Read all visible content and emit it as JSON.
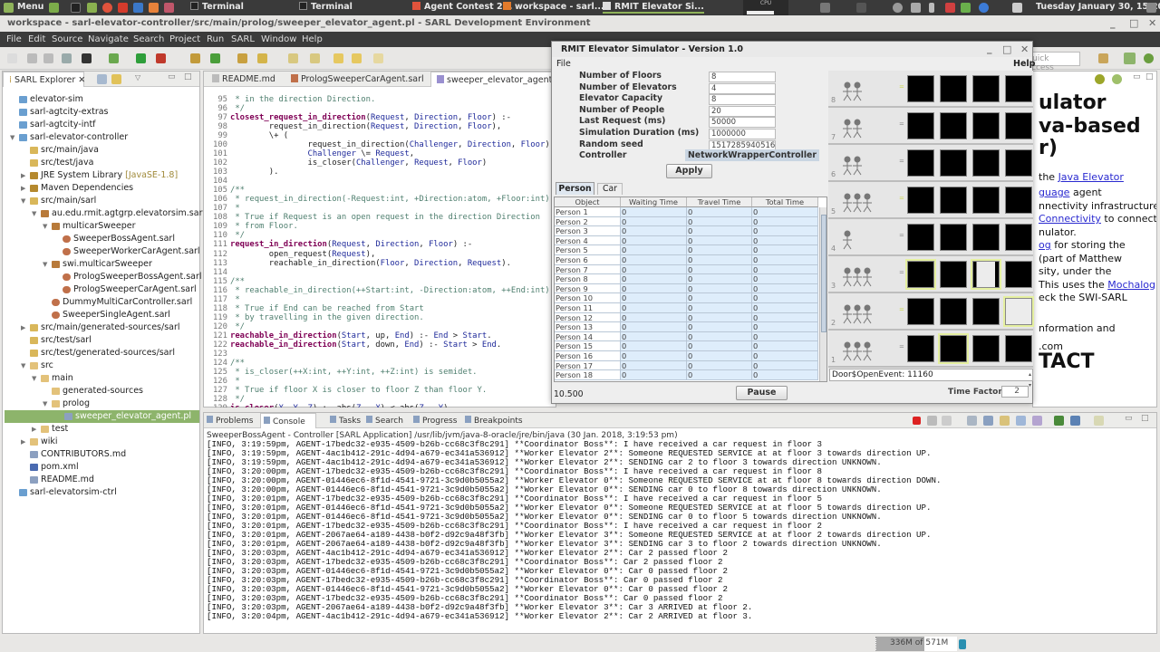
{
  "taskbar": {
    "menu": "Menu",
    "windows": [
      {
        "label": "Terminal",
        "active": false
      },
      {
        "label": "Terminal",
        "active": false
      },
      {
        "label": "Agent Contest 2...",
        "active": false
      },
      {
        "label": "workspace - sarl...",
        "active": false
      },
      {
        "label": "RMIT Elevator Si...",
        "active": true
      }
    ],
    "cpu": "CPU",
    "clock": "Tuesday January 30, 15:20"
  },
  "window": {
    "title": "workspace - sarl-elevator-controller/src/main/prolog/sweeper_elevator_agent.pl - SARL Development Environment"
  },
  "menu": [
    "File",
    "Edit",
    "Source",
    "Navigate",
    "Search",
    "Project",
    "Run",
    "SARL",
    "Window",
    "Help"
  ],
  "quick_access": {
    "placeholder": "Quick Access"
  },
  "explorer": {
    "title": "SARL Explorer",
    "items": [
      {
        "level": 0,
        "label": "elevator-sim",
        "icon": "project",
        "exp": ""
      },
      {
        "level": 0,
        "label": "sarl-agtcity-extras",
        "icon": "project",
        "exp": ""
      },
      {
        "level": 0,
        "label": "sarl-agtcity-intf",
        "icon": "project",
        "exp": ""
      },
      {
        "level": 0,
        "label": "sarl-elevator-controller",
        "icon": "project",
        "exp": "open"
      },
      {
        "level": 1,
        "label": "src/main/java",
        "icon": "srcfolder",
        "exp": ""
      },
      {
        "level": 1,
        "label": "src/test/java",
        "icon": "srcfolder",
        "exp": ""
      },
      {
        "level": 1,
        "label": "JRE System Library",
        "suffix": "[JavaSE-1.8]",
        "icon": "library",
        "exp": "closed"
      },
      {
        "level": 1,
        "label": "Maven Dependencies",
        "icon": "library",
        "exp": "closed"
      },
      {
        "level": 1,
        "label": "src/main/sarl",
        "icon": "srcfolder",
        "exp": "open"
      },
      {
        "level": 2,
        "label": "au.edu.rmit.agtgrp.elevatorsim.sarlctr",
        "icon": "package",
        "exp": "open"
      },
      {
        "level": 3,
        "label": "multicarSweeper",
        "icon": "package",
        "exp": "open"
      },
      {
        "level": 4,
        "label": "SweeperBossAgent.sarl",
        "icon": "sarl",
        "exp": ""
      },
      {
        "level": 4,
        "label": "SweeperWorkerCarAgent.sarl",
        "icon": "sarl",
        "exp": ""
      },
      {
        "level": 3,
        "label": "swi.multicarSweeper",
        "icon": "package",
        "exp": "open"
      },
      {
        "level": 4,
        "label": "PrologSweeperBossAgent.sarl",
        "icon": "sarl",
        "exp": ""
      },
      {
        "level": 4,
        "label": "PrologSweeperCarAgent.sarl",
        "icon": "sarl",
        "exp": ""
      },
      {
        "level": 3,
        "label": "DummyMultiCarController.sarl",
        "icon": "sarl",
        "exp": ""
      },
      {
        "level": 3,
        "label": "SweeperSingleAgent.sarl",
        "icon": "sarl",
        "exp": ""
      },
      {
        "level": 1,
        "label": "src/main/generated-sources/sarl",
        "icon": "srcfolder",
        "exp": "closed"
      },
      {
        "level": 1,
        "label": "src/test/sarl",
        "icon": "srcfolder",
        "exp": ""
      },
      {
        "level": 1,
        "label": "src/test/generated-sources/sarl",
        "icon": "srcfolder",
        "exp": ""
      },
      {
        "level": 1,
        "label": "src",
        "icon": "folder",
        "exp": "open"
      },
      {
        "level": 2,
        "label": "main",
        "icon": "folder",
        "exp": "open"
      },
      {
        "level": 3,
        "label": "generated-sources",
        "icon": "folder",
        "exp": ""
      },
      {
        "level": 3,
        "label": "prolog",
        "icon": "folder",
        "exp": "open"
      },
      {
        "level": 4,
        "label": "sweeper_elevator_agent.pl",
        "icon": "file",
        "exp": "",
        "selected": true
      },
      {
        "level": 2,
        "label": "test",
        "icon": "folder",
        "exp": "closed"
      },
      {
        "level": 1,
        "label": "wiki",
        "icon": "folder",
        "exp": "closed"
      },
      {
        "level": 1,
        "label": "CONTRIBUTORS.md",
        "icon": "file",
        "exp": ""
      },
      {
        "level": 1,
        "label": "pom.xml",
        "icon": "xml",
        "exp": ""
      },
      {
        "level": 1,
        "label": "README.md",
        "icon": "file",
        "exp": ""
      },
      {
        "level": 0,
        "label": "sarl-elevatorsim-ctrl",
        "icon": "project",
        "exp": ""
      }
    ]
  },
  "editor": {
    "tabs": [
      {
        "label": "README.md",
        "active": false
      },
      {
        "label": "PrologSweeperCarAgent.sarl",
        "active": false
      },
      {
        "label": "sweeper_elevator_agent.pl",
        "active": true
      }
    ],
    "lines": [
      {
        "n": 95,
        "t": " * in the direction Direction."
      },
      {
        "n": 96,
        "t": " */"
      },
      {
        "n": 97,
        "t": "closest_request_in_direction(Request, Direction, Floor) :-"
      },
      {
        "n": 98,
        "t": "        request_in_direction(Request, Direction, Floor),"
      },
      {
        "n": 99,
        "t": "        \\+ ("
      },
      {
        "n": 100,
        "t": "                request_in_direction(Challenger, Direction, Floor),"
      },
      {
        "n": 101,
        "t": "                Challenger \\= Request,"
      },
      {
        "n": 102,
        "t": "                is_closer(Challenger, Request, Floor)"
      },
      {
        "n": 103,
        "t": "        )."
      },
      {
        "n": 104,
        "t": ""
      },
      {
        "n": 105,
        "t": "/**"
      },
      {
        "n": 106,
        "t": " * request_in_direction(-Request:int, +Direction:atom, +Floor:int)"
      },
      {
        "n": 107,
        "t": " *"
      },
      {
        "n": 108,
        "t": " * True if Request is an open request in the direction Direction"
      },
      {
        "n": 109,
        "t": " * from Floor."
      },
      {
        "n": 110,
        "t": " */"
      },
      {
        "n": 111,
        "t": "request_in_direction(Request, Direction, Floor) :-"
      },
      {
        "n": 112,
        "t": "        open_request(Request),"
      },
      {
        "n": 113,
        "t": "        reachable_in_direction(Floor, Direction, Request)."
      },
      {
        "n": 114,
        "t": ""
      },
      {
        "n": 115,
        "t": "/**"
      },
      {
        "n": 116,
        "t": " * reachable_in_direction(++Start:int, -Direction:atom, ++End:int)"
      },
      {
        "n": 117,
        "t": " *"
      },
      {
        "n": 118,
        "t": " * True if End can be reached from Start"
      },
      {
        "n": 119,
        "t": " * by travelling in the given direction."
      },
      {
        "n": 120,
        "t": " */"
      },
      {
        "n": 121,
        "t": "reachable_in_direction(Start, up, End) :- End > Start."
      },
      {
        "n": 122,
        "t": "reachable_in_direction(Start, down, End) :- Start > End."
      },
      {
        "n": 123,
        "t": ""
      },
      {
        "n": 124,
        "t": "/**"
      },
      {
        "n": 125,
        "t": " * is_closer(++X:int, ++Y:int, ++Z:int) is semidet."
      },
      {
        "n": 126,
        "t": " *"
      },
      {
        "n": 127,
        "t": " * True if floor X is closer to floor Z than floor Y."
      },
      {
        "n": 128,
        "t": " */"
      },
      {
        "n": 129,
        "t": "is_closer(X, Y, Z) :- abs(Z - X) < abs(Z - Y)."
      }
    ]
  },
  "simulator": {
    "title": "RMIT Elevator Simulator - Version 1.0",
    "menu_file": "File",
    "menu_help": "Help",
    "fields": [
      {
        "label": "Number of Floors",
        "value": "8"
      },
      {
        "label": "Number of Elevators",
        "value": "4"
      },
      {
        "label": "Elevator Capacity",
        "value": "8"
      },
      {
        "label": "Number of People",
        "value": "20"
      },
      {
        "label": "Last Request (ms)",
        "value": "50000"
      },
      {
        "label": "Simulation Duration (ms)",
        "value": "1000000"
      },
      {
        "label": "Random seed",
        "value": "1517285940516"
      }
    ],
    "controller_label": "Controller",
    "controller_value": "NetworkWrapperController",
    "apply": "Apply",
    "tabs": [
      "Person",
      "Car"
    ],
    "columns": [
      "Object",
      "Waiting Time",
      "Travel Time",
      "Total Time"
    ],
    "rows": [
      [
        "Person 1",
        "0",
        "0",
        "0"
      ],
      [
        "Person 2",
        "0",
        "0",
        "0"
      ],
      [
        "Person 3",
        "0",
        "0",
        "0"
      ],
      [
        "Person 4",
        "0",
        "0",
        "0"
      ],
      [
        "Person 5",
        "0",
        "0",
        "0"
      ],
      [
        "Person 6",
        "0",
        "0",
        "0"
      ],
      [
        "Person 7",
        "0",
        "0",
        "0"
      ],
      [
        "Person 8",
        "0",
        "0",
        "0"
      ],
      [
        "Person 9",
        "0",
        "0",
        "0"
      ],
      [
        "Person 10",
        "0",
        "0",
        "0"
      ],
      [
        "Person 11",
        "0",
        "0",
        "0"
      ],
      [
        "Person 12",
        "0",
        "0",
        "0"
      ],
      [
        "Person 13",
        "0",
        "0",
        "0"
      ],
      [
        "Person 14",
        "0",
        "0",
        "0"
      ],
      [
        "Person 15",
        "0",
        "0",
        "0"
      ],
      [
        "Person 16",
        "0",
        "0",
        "0"
      ],
      [
        "Person 17",
        "0",
        "0",
        "0"
      ],
      [
        "Person 18",
        "0",
        "0",
        "0"
      ]
    ],
    "clock": "10.500",
    "pause": "Pause",
    "event_log": "Door$OpenEvent: 11160",
    "time_factor_label": "Time Factor",
    "time_factor": "2",
    "floors": [
      {
        "floor": "8",
        "people": 2,
        "cars": [
          "closed",
          "closed",
          "closed",
          "closed"
        ]
      },
      {
        "floor": "7",
        "people": 2,
        "cars": [
          "closed",
          "closed",
          "closed",
          "closed"
        ]
      },
      {
        "floor": "6",
        "people": 2,
        "cars": [
          "closed",
          "closed",
          "closed",
          "closed"
        ]
      },
      {
        "floor": "5",
        "people": 3,
        "cars": [
          "closed",
          "closed",
          "closed",
          "closed"
        ]
      },
      {
        "floor": "4",
        "people": 1,
        "cars": [
          "closed",
          "closed",
          "closed",
          "closed"
        ]
      },
      {
        "floor": "3",
        "people": 3,
        "cars": [
          "closed-hl",
          "closed",
          "half-hl",
          "closed"
        ]
      },
      {
        "floor": "2",
        "people": 3,
        "cars": [
          "closed",
          "closed",
          "closed",
          "open-hl"
        ]
      },
      {
        "floor": "1",
        "people": 3,
        "cars": [
          "closed",
          "closed-hl",
          "closed",
          "closed"
        ]
      }
    ]
  },
  "readme": [
    {
      "t": "ulator",
      "h": true
    },
    {
      "t": "va-based",
      "h": true
    },
    {
      "t": "r)",
      "h": true
    },
    {
      "pre": "the ",
      "link": "Java Elevator",
      "post": ""
    },
    {
      "pre": "",
      "link": "guage",
      "post": " agent"
    },
    {
      "pre": "nnectivity infrastructure",
      "link": "",
      "post": ""
    },
    {
      "pre": "",
      "link": "Connectivity",
      "post": " to connect"
    },
    {
      "pre": "nulator.",
      "link": "",
      "post": ""
    },
    {
      "pre": "",
      "link": "og",
      "post": " for storing the"
    },
    {
      "pre": "(part of Matthew",
      "link": "",
      "post": ""
    },
    {
      "pre": "sity, under the",
      "link": "",
      "post": ""
    },
    {
      "pre": "This uses the ",
      "link": "Mochalog",
      "post": ""
    },
    {
      "pre": "eck the SWI-SARL",
      "link": "",
      "post": ""
    },
    {
      "pre": "nformation and",
      "link": "",
      "post": ""
    },
    {
      "t": "TACT",
      "h": true
    },
    {
      "pre": ".com",
      "link": "",
      "post": ""
    }
  ],
  "console": {
    "tabs": [
      {
        "label": "Problems",
        "active": false
      },
      {
        "label": "Console",
        "active": true
      },
      {
        "label": "Tasks",
        "active": false
      },
      {
        "label": "Search",
        "active": false
      },
      {
        "label": "Progress",
        "active": false
      },
      {
        "label": "Breakpoints",
        "active": false
      }
    ],
    "header": "SweeperBossAgent - Controller [SARL Application] /usr/lib/jvm/java-8-oracle/jre/bin/java (30 Jan. 2018, 3:19:53 pm)",
    "lines": [
      "[INFO, 3:19:59pm, AGENT-17bedc32-e935-4509-b26b-cc68c3f8c291] **Coordinator Boss**: I have received a car request in floor 3",
      "[INFO, 3:19:59pm, AGENT-4ac1b412-291c-4d94-a679-ec341a536912] **Worker Elevator 2**: Someone REQUESTED SERVICE at at floor 3 towards direction UP.",
      "[INFO, 3:19:59pm, AGENT-4ac1b412-291c-4d94-a679-ec341a536912] **Worker Elevator 2**: SENDING car 2 to floor 3 towards direction UNKNOWN.",
      "[INFO, 3:20:00pm, AGENT-17bedc32-e935-4509-b26b-cc68c3f8c291] **Coordinator Boss**: I have received a car request in floor 8",
      "[INFO, 3:20:00pm, AGENT-01446ec6-8f1d-4541-9721-3c9d0b5055a2] **Worker Elevator 0**: Someone REQUESTED SERVICE at at floor 8 towards direction DOWN.",
      "[INFO, 3:20:00pm, AGENT-01446ec6-8f1d-4541-9721-3c9d0b5055a2] **Worker Elevator 0**: SENDING car 0 to floor 8 towards direction UNKNOWN.",
      "[INFO, 3:20:01pm, AGENT-17bedc32-e935-4509-b26b-cc68c3f8c291] **Coordinator Boss**: I have received a car request in floor 5",
      "[INFO, 3:20:01pm, AGENT-01446ec6-8f1d-4541-9721-3c9d0b5055a2] **Worker Elevator 0**: Someone REQUESTED SERVICE at at floor 5 towards direction UP.",
      "[INFO, 3:20:01pm, AGENT-01446ec6-8f1d-4541-9721-3c9d0b5055a2] **Worker Elevator 0**: SENDING car 0 to floor 5 towards direction UNKNOWN.",
      "[INFO, 3:20:01pm, AGENT-17bedc32-e935-4509-b26b-cc68c3f8c291] **Coordinator Boss**: I have received a car request in floor 2",
      "[INFO, 3:20:01pm, AGENT-2067ae64-a189-4438-b0f2-d92c9a48f3fb] **Worker Elevator 3**: Someone REQUESTED SERVICE at at floor 2 towards direction UP.",
      "[INFO, 3:20:01pm, AGENT-2067ae64-a189-4438-b0f2-d92c9a48f3fb] **Worker Elevator 3**: SENDING car 3 to floor 2 towards direction UNKNOWN.",
      "[INFO, 3:20:03pm, AGENT-4ac1b412-291c-4d94-a679-ec341a536912] **Worker Elevator 2**: Car 2 passed floor 2",
      "[INFO, 3:20:03pm, AGENT-17bedc32-e935-4509-b26b-cc68c3f8c291] **Coordinator Boss**: Car 2 passed floor 2",
      "[INFO, 3:20:03pm, AGENT-01446ec6-8f1d-4541-9721-3c9d0b5055a2] **Worker Elevator 0**: Car 0 passed floor 2",
      "[INFO, 3:20:03pm, AGENT-17bedc32-e935-4509-b26b-cc68c3f8c291] **Coordinator Boss**: Car 0 passed floor 2",
      "[INFO, 3:20:03pm, AGENT-01446ec6-8f1d-4541-9721-3c9d0b5055a2] **Worker Elevator 0**: Car 0 passed floor 2",
      "[INFO, 3:20:03pm, AGENT-17bedc32-e935-4509-b26b-cc68c3f8c291] **Coordinator Boss**: Car 0 passed floor 2",
      "[INFO, 3:20:03pm, AGENT-2067ae64-a189-4438-b0f2-d92c9a48f3fb] **Worker Elevator 3**: Car 3 ARRIVED at floor 2.",
      "[INFO, 3:20:04pm, AGENT-4ac1b412-291c-4d94-a679-ec341a536912] **Worker Elevator 2**: Car 2 ARRIVED at floor 3."
    ]
  },
  "status": {
    "memory": "336M of 571M",
    "heap_used_fraction": 0.59
  },
  "colors": {
    "accent": "#8db46b",
    "selection": "#8db46b",
    "link": "#2a2ad0",
    "car": "#000000",
    "highlight": "#e5f0a0"
  }
}
